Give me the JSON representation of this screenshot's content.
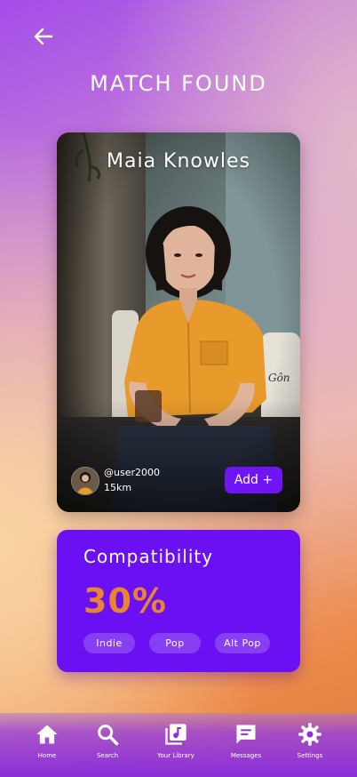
{
  "header": {
    "title": "MATCH FOUND",
    "back_icon": "arrow-left-icon"
  },
  "match": {
    "name": "Maia Knowles",
    "handle": "@user2000",
    "distance": "15km",
    "add_label": "Add +"
  },
  "compatibility": {
    "title": "Compatibility",
    "value": "30%",
    "tags": [
      "Indie",
      "Pop",
      "Alt Pop"
    ]
  },
  "nav": {
    "items": [
      {
        "label": "Home",
        "icon": "home-icon"
      },
      {
        "label": "Search",
        "icon": "search-icon"
      },
      {
        "label": "Your Library",
        "icon": "library-icon"
      },
      {
        "label": "Messages",
        "icon": "messages-icon"
      },
      {
        "label": "Settings",
        "icon": "gear-icon"
      }
    ]
  },
  "colors": {
    "accent": "#6a10f2",
    "compat_value": "#e9842f",
    "button": "#6f14f4"
  }
}
